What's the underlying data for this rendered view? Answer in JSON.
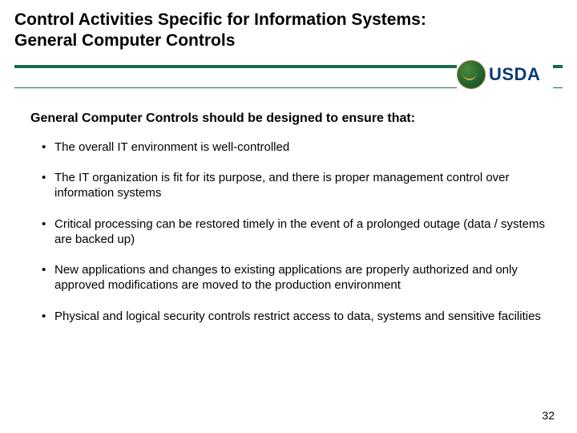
{
  "header": {
    "title_line1": "Control Activities Specific for Information Systems:",
    "title_line2": "General Computer Controls"
  },
  "logo": {
    "text": "USDA",
    "icon_name": "usda-seal"
  },
  "content": {
    "lead": "General Computer Controls should be designed to ensure that:",
    "bullets": [
      "The overall IT environment is well-controlled",
      "The IT organization is fit for its purpose, and there is proper management control over information systems",
      "Critical processing can be restored timely in the event of a prolonged outage (data / systems are backed up)",
      "New applications and changes to existing applications are properly authorized and only approved modifications are moved to the production environment",
      "Physical and logical security controls restrict access to data, systems and sensitive facilities"
    ]
  },
  "page_number": "32"
}
